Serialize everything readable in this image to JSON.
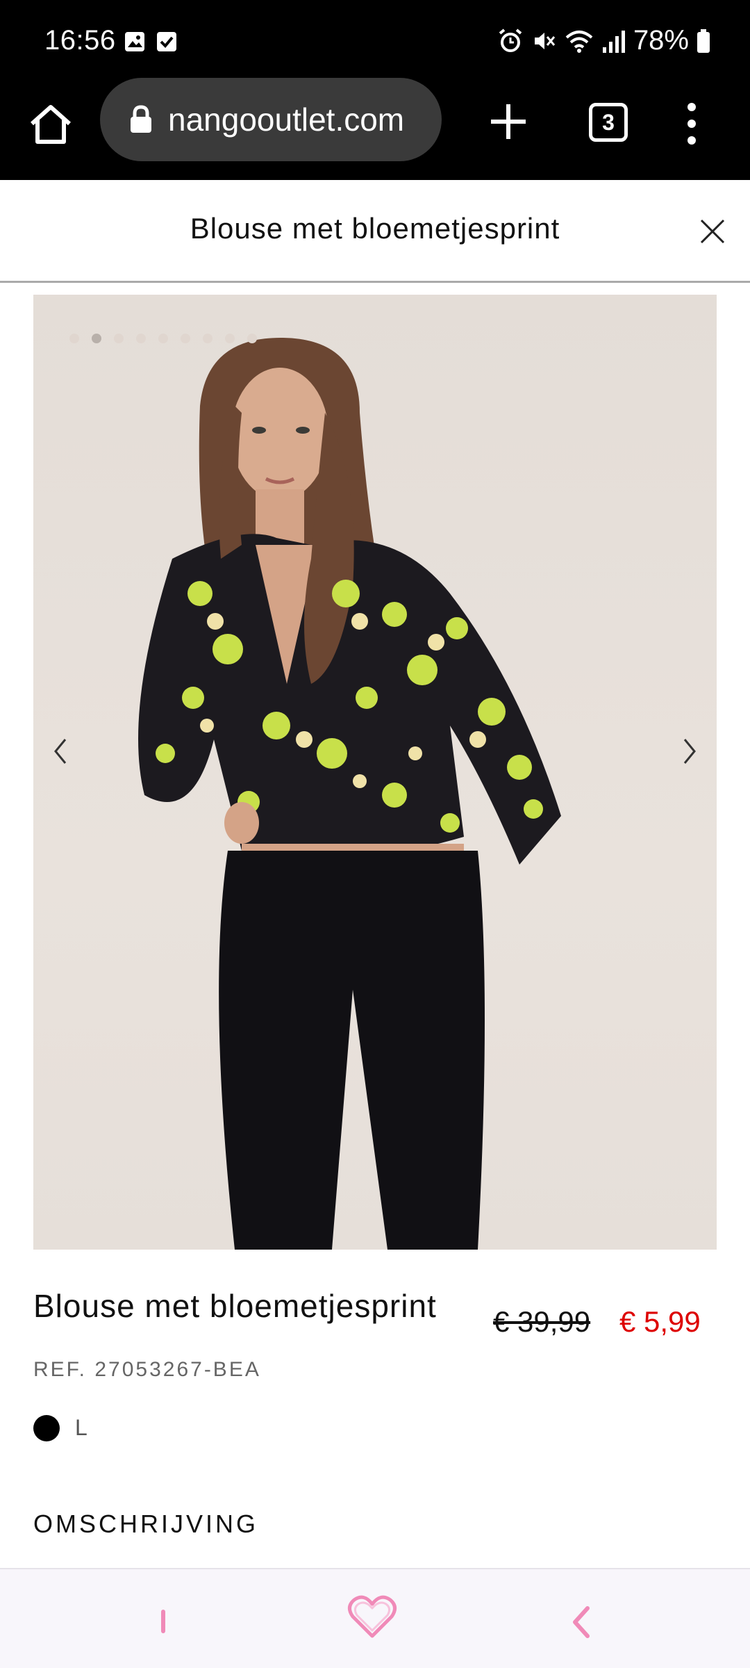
{
  "status_bar": {
    "time": "16:56",
    "battery": "78%",
    "left_icons": [
      "image-icon",
      "check-box-icon"
    ],
    "right_icons": [
      "alarm-icon",
      "mute-icon",
      "wifi-icon",
      "signal-icon",
      "battery-icon"
    ]
  },
  "browser": {
    "url": "nangooutlet.com",
    "tab_count": "3"
  },
  "page": {
    "title": "Blouse met bloemetjesprint"
  },
  "product": {
    "name": "Blouse met bloemetjesprint",
    "price_old": "€ 39,99",
    "price_new": "€ 5,99",
    "ref": "REF. 27053267-BEA",
    "color": "#000000",
    "size": "L",
    "image_count": 9,
    "active_image": 2
  },
  "section": {
    "description_heading": "OMSCHRIJVING"
  },
  "colors": {
    "sale_price": "#dd0000",
    "accent_pink": "#f08ab8"
  }
}
